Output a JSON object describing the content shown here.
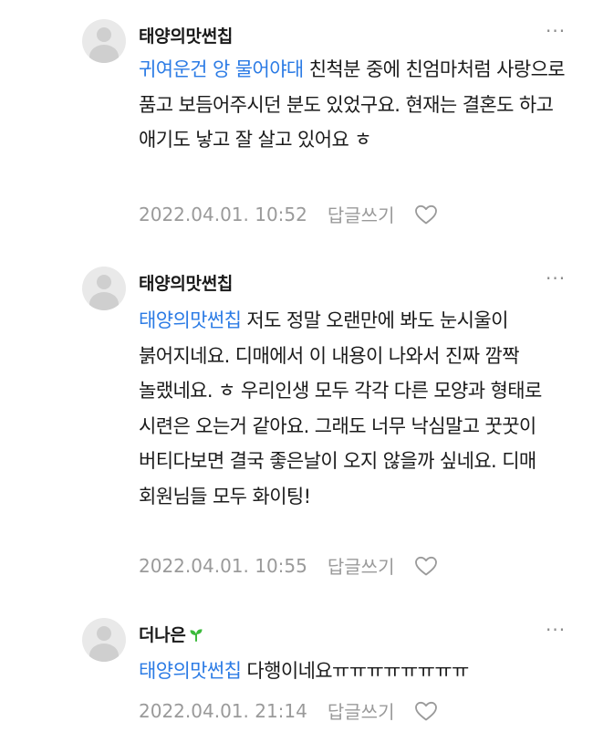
{
  "comments": [
    {
      "nickname": "태양의맛썬칩",
      "mention": "귀여운건 앙 물어야대",
      "text": " 친척분 중에 친엄마처럼 사랑으로 품고 보듬어주시던 분도 있었구요. 현재는 결혼도 하고 애기도 낳고 잘 살고 있어요 ㅎ",
      "date": "2022.04.01. 10:52",
      "reply_label": "답글쓰기"
    },
    {
      "nickname": "태양의맛썬칩",
      "mention": "태양의맛썬칩",
      "text": " 저도 정말 오랜만에 봐도 눈시울이 붉어지네요. 디매에서 이 내용이 나와서 진짜 깜짝 놀랬네요. ㅎ 우리인생 모두 각각 다른 모양과 형태로 시련은 오는거 같아요. 그래도 너무 낙심말고 꿋꿋이 버티다보면 결국 좋은날이 오지 않을까 싶네요. 디매 회원님들 모두 화이팅!",
      "date": "2022.04.01. 10:55",
      "reply_label": "답글쓰기"
    },
    {
      "nickname": "더나은",
      "mention": "태양의맛썬칩",
      "text": " 다행이네요ㅠㅠㅠㅠㅠㅠㅠㅠ",
      "date": "2022.04.01. 21:14",
      "reply_label": "답글쓰기"
    }
  ],
  "icons": {
    "more": "more-icon",
    "like": "heart-icon",
    "avatar": "default-avatar-icon",
    "badge": "sprout-icon"
  },
  "colors": {
    "mention": "#2b7be5",
    "meta": "#9a9a9a",
    "badge": "#3cba3c"
  }
}
